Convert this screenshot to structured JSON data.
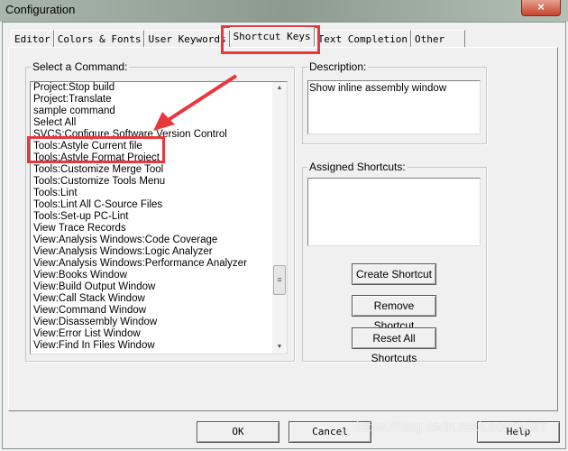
{
  "window": {
    "title": "Configuration",
    "close_icon": "×"
  },
  "tabs": [
    "Editor",
    "Colors & Fonts",
    "User Keywords",
    "Shortcut Keys",
    "Text Completion",
    "Other"
  ],
  "active_tab": "Shortcut Keys",
  "commands": {
    "label": "Select a Command:",
    "items": [
      "Project:Stop build",
      "Project:Translate",
      "sample command",
      "Select All",
      "SVCS:Configure Software Version Control",
      "Tools:Astyle Current file",
      "Tools:Astyle Format Project",
      "Tools:Customize Merge Tool",
      "Tools:Customize Tools Menu",
      "Tools:Lint",
      "Tools:Lint All C-Source Files",
      "Tools:Set-up PC-Lint",
      "View Trace Records",
      "View:Analysis Windows:Code Coverage",
      "View:Analysis Windows:Logic Analyzer",
      "View:Analysis Windows:Performance Analyzer",
      "View:Books Window",
      "View:Build Output Window",
      "View:Call Stack Window",
      "View:Command Window",
      "View:Disassembly Window",
      "View:Error List Window",
      "View:Find In Files Window"
    ]
  },
  "description": {
    "label": "Description:",
    "text": "Show inline assembly window"
  },
  "shortcuts": {
    "label": "Assigned Shortcuts:",
    "create": "Create Shortcut",
    "remove": "Remove Shortcut",
    "reset": "Reset All Shortcuts"
  },
  "footer": {
    "ok": "OK",
    "cancel": "Cancel",
    "help": "Help"
  },
  "watermark": "https://blog.csdn.net/LeonSUST",
  "annotation_color": "#e8383d"
}
